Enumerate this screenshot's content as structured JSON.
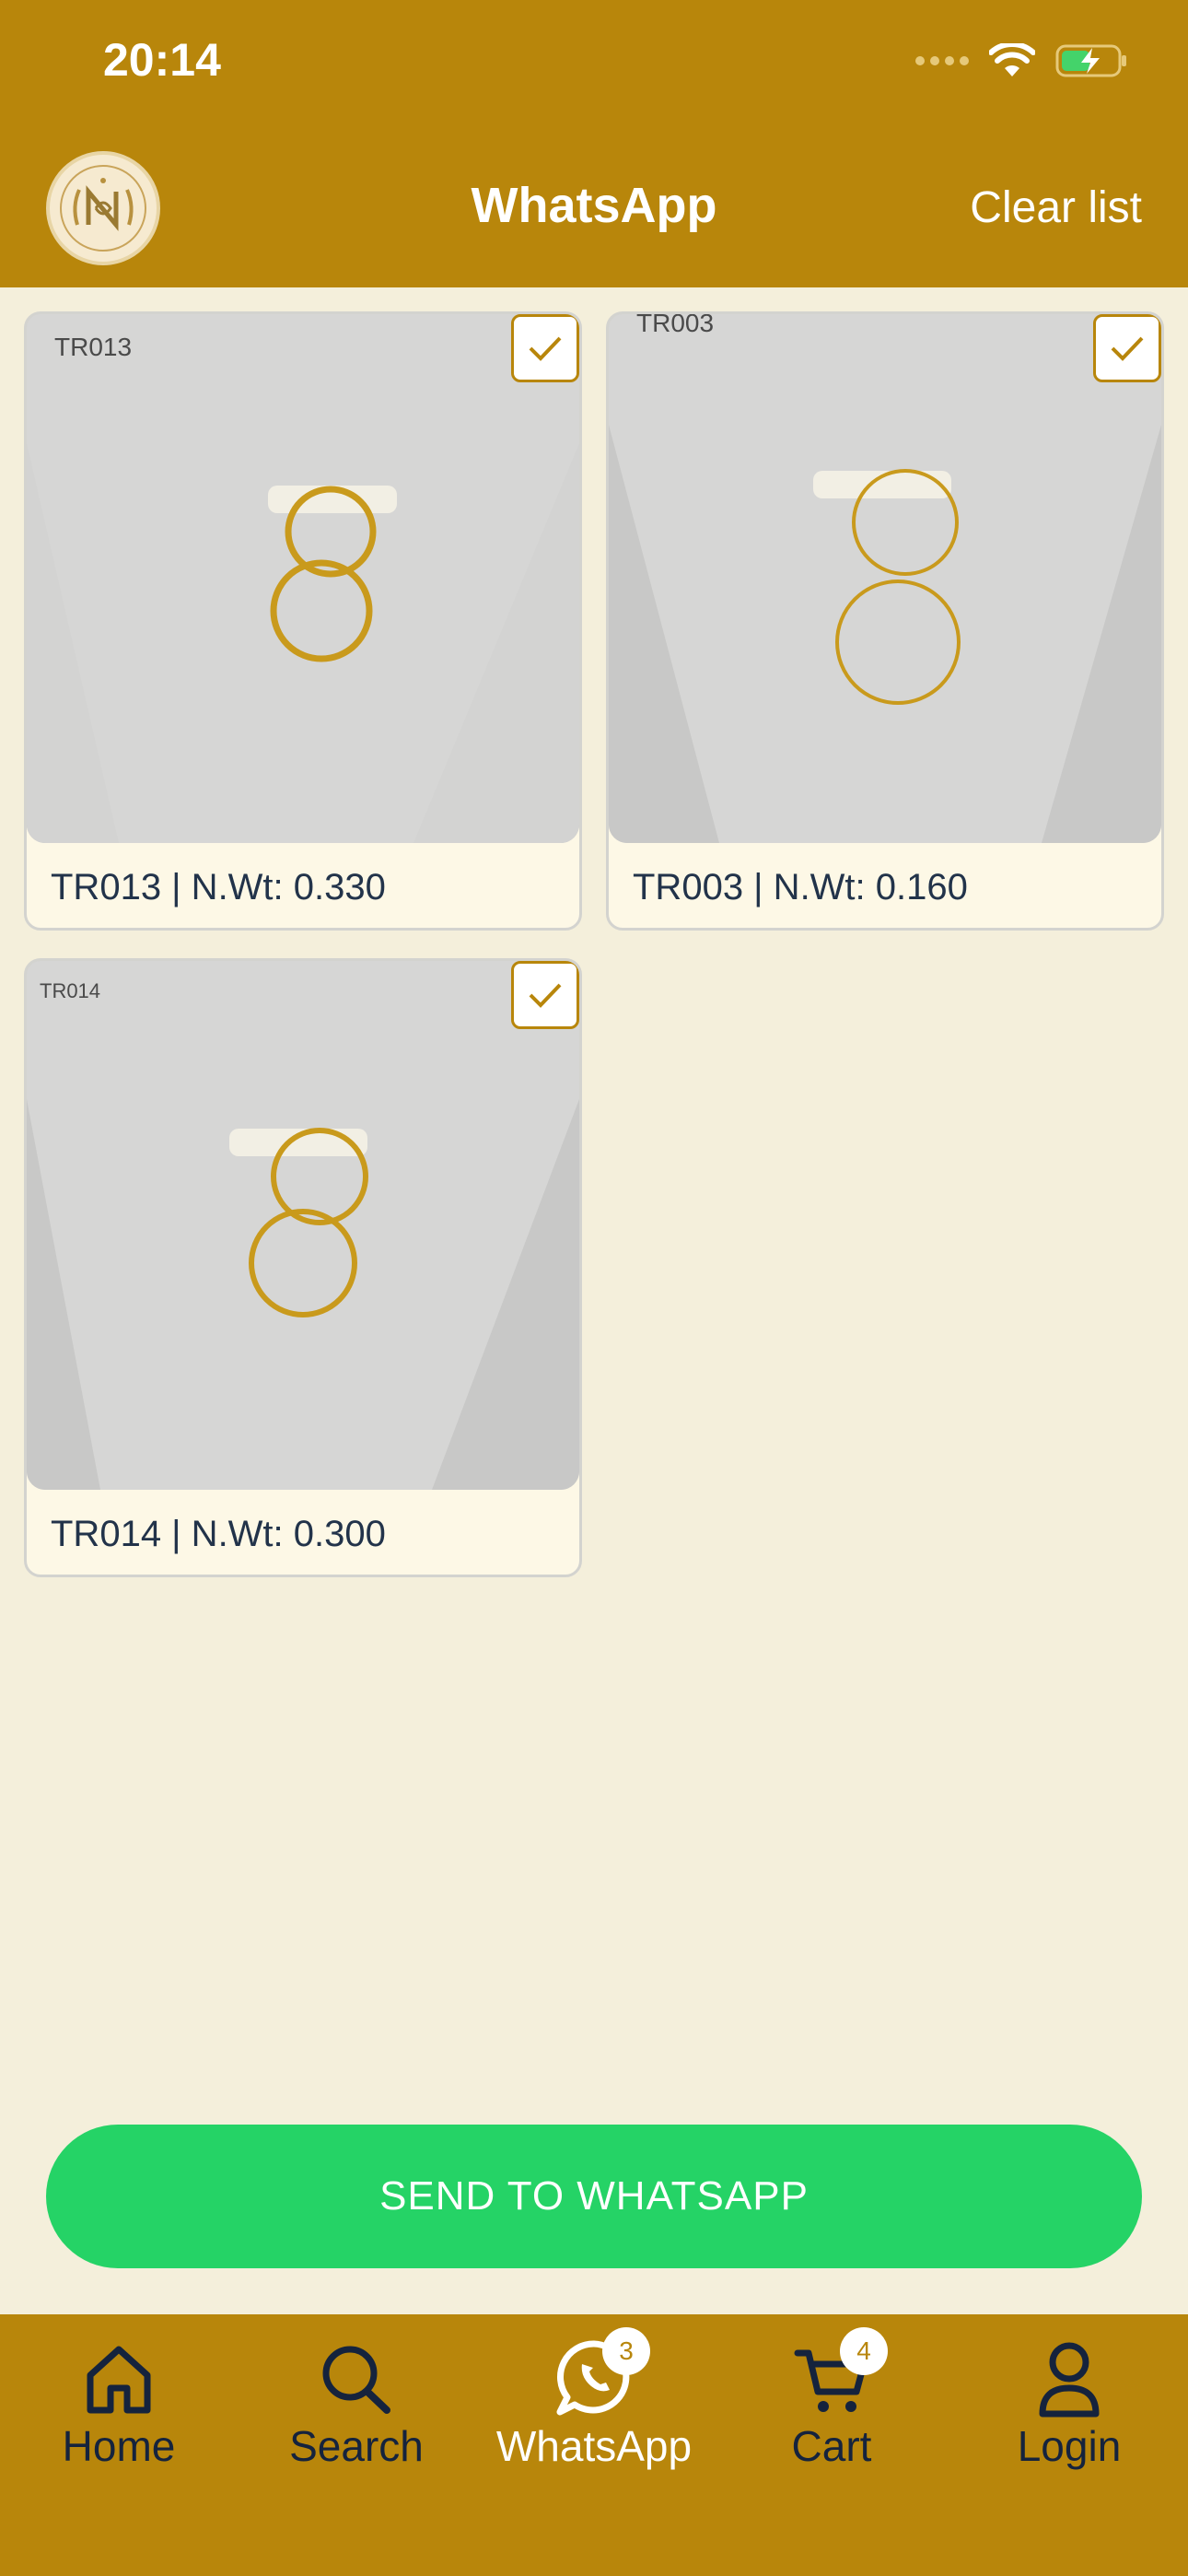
{
  "status": {
    "time": "20:14"
  },
  "header": {
    "title": "WhatsApp",
    "clear_label": "Clear list"
  },
  "products": [
    {
      "code": "TR013",
      "caption": "TR013 | N.Wt: 0.330",
      "checked": true
    },
    {
      "code": "TR003",
      "caption": "TR003 | N.Wt: 0.160",
      "checked": true
    },
    {
      "code": "TR014",
      "caption": "TR014 | N.Wt: 0.300",
      "checked": true
    }
  ],
  "send_button": {
    "label": "SEND TO WHATSAPP"
  },
  "nav": {
    "home": {
      "label": "Home"
    },
    "search": {
      "label": "Search"
    },
    "whatsapp": {
      "label": "WhatsApp",
      "badge": "3"
    },
    "cart": {
      "label": "Cart",
      "badge": "4"
    },
    "login": {
      "label": "Login"
    }
  },
  "colors": {
    "brand": "#b8860b",
    "background": "#f4efdb",
    "whatsapp_green": "#25d366",
    "nav_text": "#15233d"
  }
}
